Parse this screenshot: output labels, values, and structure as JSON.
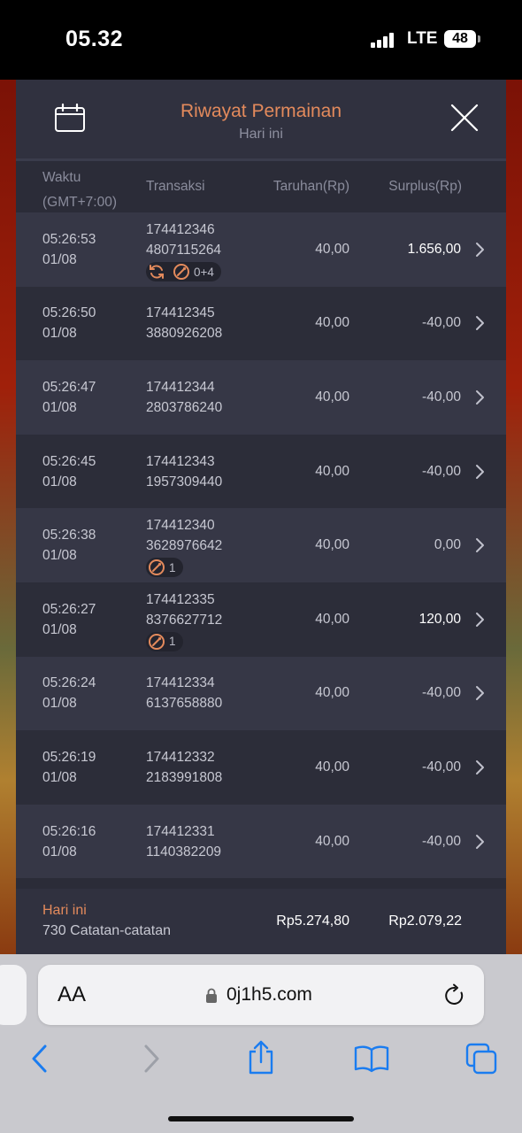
{
  "status_bar": {
    "time": "05.32",
    "network": "LTE",
    "battery": "48"
  },
  "panel": {
    "title": "Riwayat Permainan",
    "subtitle": "Hari ini",
    "columns": {
      "time_line1": "Waktu",
      "time_line2": "(GMT+7:00)",
      "transaction": "Transaksi",
      "bet": "Taruhan(Rp)",
      "surplus": "Surplus(Rp)"
    },
    "rows": [
      {
        "time": "05:26:53",
        "date": "01/08",
        "id1": "174412346",
        "id2": "4807115264",
        "bet": "40,00",
        "surplus": "1.656,00",
        "positive": true,
        "badge": {
          "respin": true,
          "count": "0+4"
        }
      },
      {
        "time": "05:26:50",
        "date": "01/08",
        "id1": "174412345",
        "id2": "3880926208",
        "bet": "40,00",
        "surplus": "-40,00",
        "positive": false
      },
      {
        "time": "05:26:47",
        "date": "01/08",
        "id1": "174412344",
        "id2": "2803786240",
        "bet": "40,00",
        "surplus": "-40,00",
        "positive": false
      },
      {
        "time": "05:26:45",
        "date": "01/08",
        "id1": "174412343",
        "id2": "1957309440",
        "bet": "40,00",
        "surplus": "-40,00",
        "positive": false
      },
      {
        "time": "05:26:38",
        "date": "01/08",
        "id1": "174412340",
        "id2": "3628976642",
        "bet": "40,00",
        "surplus": "0,00",
        "positive": false,
        "badge": {
          "respin": false,
          "count": "1"
        }
      },
      {
        "time": "05:26:27",
        "date": "01/08",
        "id1": "174412335",
        "id2": "8376627712",
        "bet": "40,00",
        "surplus": "120,00",
        "positive": true,
        "badge": {
          "respin": false,
          "count": "1"
        }
      },
      {
        "time": "05:26:24",
        "date": "01/08",
        "id1": "174412334",
        "id2": "6137658880",
        "bet": "40,00",
        "surplus": "-40,00",
        "positive": false
      },
      {
        "time": "05:26:19",
        "date": "01/08",
        "id1": "174412332",
        "id2": "2183991808",
        "bet": "40,00",
        "surplus": "-40,00",
        "positive": false
      },
      {
        "time": "05:26:16",
        "date": "01/08",
        "id1": "174412331",
        "id2": "1140382209",
        "bet": "40,00",
        "surplus": "-40,00",
        "positive": false
      }
    ],
    "footer": {
      "label": "Hari ini",
      "count": "730 Catatan-catatan",
      "total_bet": "Rp5.274,80",
      "total_surplus": "Rp2.079,22"
    }
  },
  "browser": {
    "text_size_label": "AA",
    "url": "0j1h5.com"
  },
  "colors": {
    "accent": "#e38a5c",
    "panel_bg": "#2b2c38",
    "ios_blue": "#1a7cf0"
  }
}
